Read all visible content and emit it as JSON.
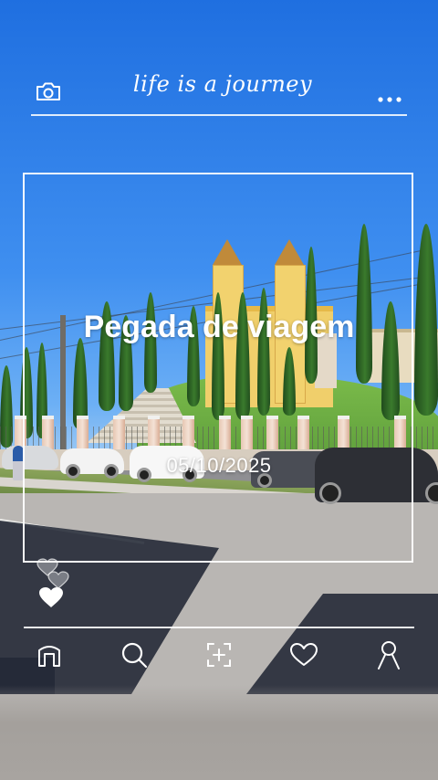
{
  "header": {
    "brand_text": "life is a journey",
    "camera_icon": "camera-icon",
    "more_icon": "more-dots-icon"
  },
  "post": {
    "title": "Pegada de viagem",
    "date": "05/10/2025"
  },
  "reactions": {
    "icons": [
      "heart-outline-icon",
      "heart-outline-icon",
      "heart-filled-icon"
    ]
  },
  "nav": {
    "items": [
      {
        "icon": "home-icon"
      },
      {
        "icon": "search-icon"
      },
      {
        "icon": "add-frame-icon"
      },
      {
        "icon": "heart-icon"
      },
      {
        "icon": "profile-icon"
      }
    ]
  },
  "colors": {
    "overlay": "#ffffff",
    "sky": "#2f7be0"
  }
}
